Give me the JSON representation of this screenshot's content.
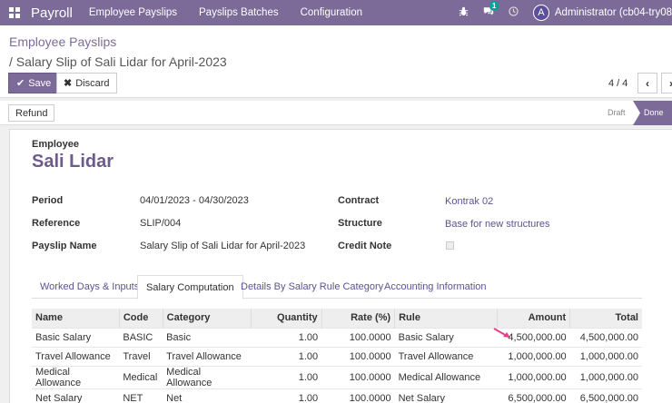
{
  "navbar": {
    "brand": "Payroll",
    "menu": [
      "Employee Payslips",
      "Payslips Batches",
      "Configuration"
    ],
    "messages_count": "1",
    "avatar_letter": "A",
    "user": "Administrator (cb04-try08",
    "color": "#7c6b98"
  },
  "breadcrumb": {
    "parent": "Employee Payslips",
    "current": "/ Salary Slip of Sali Lidar for April-2023"
  },
  "buttons": {
    "save": "Save",
    "discard": "Discard",
    "refund": "Refund"
  },
  "pager": {
    "value": "4 / 4"
  },
  "status": {
    "draft": "Draft",
    "done": "Done"
  },
  "form": {
    "employee_label": "Employee",
    "employee_name": "Sali Lidar",
    "period_label": "Period",
    "period": "04/01/2023 - 04/30/2023",
    "reference_label": "Reference",
    "reference": "SLIP/004",
    "payslip_name_label": "Payslip Name",
    "payslip_name": "Salary Slip of Sali Lidar for April-2023",
    "contract_label": "Contract",
    "contract": "Kontrak 02",
    "structure_label": "Structure",
    "structure": "Base for new structures",
    "credit_note_label": "Credit Note",
    "credit_note_checked": false
  },
  "tabs": [
    "Worked Days & Inputs",
    "Salary Computation",
    "Details By Salary Rule Category",
    "Accounting Information"
  ],
  "table": {
    "headers": [
      "Name",
      "Code",
      "Category",
      "Quantity",
      "Rate (%)",
      "Rule",
      "Amount",
      "Total"
    ],
    "rows": [
      [
        "Basic Salary",
        "BASIC",
        "Basic",
        "1.00",
        "100.0000",
        "Basic Salary",
        "4,500,000.00",
        "4,500,000.00"
      ],
      [
        "Travel Allowance",
        "Travel",
        "Travel Allowance",
        "1.00",
        "100.0000",
        "Travel Allowance",
        "1,000,000.00",
        "1,000,000.00"
      ],
      [
        "Medical Allowance",
        "Medical",
        "Medical Allowance",
        "1.00",
        "100.0000",
        "Medical Allowance",
        "1,000,000.00",
        "1,000,000.00"
      ],
      [
        "Net Salary",
        "NET",
        "Net",
        "1.00",
        "100.0000",
        "Net Salary",
        "6,500,000.00",
        "6,500,000.00"
      ]
    ]
  },
  "icons": {
    "apps": "apps-grid-icon",
    "bug": "bug-icon",
    "chat": "chat-icon",
    "activity": "clock-icon",
    "save": "check-icon",
    "discard": "close-icon",
    "prev": "chevron-left-icon",
    "next": "chevron-right-icon"
  },
  "annotation_color": "#e83e8c"
}
